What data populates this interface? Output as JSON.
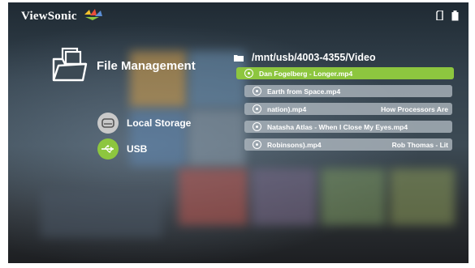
{
  "brand": {
    "name": "ViewSonic"
  },
  "panel": {
    "title": "File Management"
  },
  "sources": [
    {
      "label": "Local Storage",
      "icon": "hard-drive-icon"
    },
    {
      "label": "USB",
      "icon": "usb-icon"
    }
  ],
  "browser": {
    "path": "/mnt/usb/4003-4355/Video",
    "files": [
      {
        "name": "Dan Fogelberg - Longer.mp4",
        "extra": "",
        "selected": true
      },
      {
        "name": "Earth from Space.mp4",
        "extra": ""
      },
      {
        "name": "nation).mp4",
        "extra": "How Processors Are"
      },
      {
        "name": "Natasha Atlas - When I Close My Eyes.mp4",
        "extra": ""
      },
      {
        "name": "Robinsons).mp4",
        "extra": "Rob Thomas - Lit"
      }
    ]
  },
  "colors": {
    "accent": "#8dc63f",
    "usb": "#8dc63f",
    "local": "#c9c9c9"
  }
}
